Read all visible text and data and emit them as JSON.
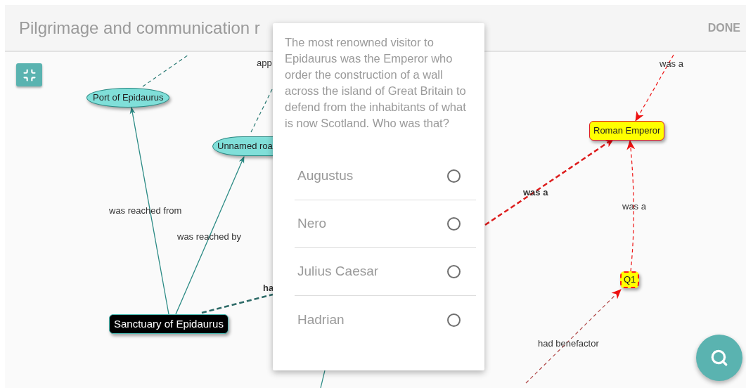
{
  "header": {
    "title": "Pilgrimage and communication r",
    "done": "DONE"
  },
  "graph": {
    "nodes": [
      {
        "label": "Port of Epidaurus",
        "kind": "place"
      },
      {
        "label": "Unnamed roa",
        "kind": "place"
      },
      {
        "label": "Sanctuary of Epidaurus",
        "kind": "focus"
      },
      {
        "label": "Roman Emperor",
        "kind": "answer"
      },
      {
        "label": "Q1",
        "kind": "question"
      }
    ],
    "edge_labels": [
      {
        "text": "app",
        "bold": false
      },
      {
        "text": "was a",
        "bold": false
      },
      {
        "text": "was reached from",
        "bold": false
      },
      {
        "text": "was reached by",
        "bold": false
      },
      {
        "text": "was a",
        "bold": true
      },
      {
        "text": "was a",
        "bold": false
      },
      {
        "text": "ha",
        "bold": true
      },
      {
        "text": "had benefactor",
        "bold": false
      }
    ]
  },
  "question": {
    "text": "The most renowned visitor to Epidaurus was the Emperor who order the construction of a wall across the island of Great Britain to defend from the inhabitants of what is now Scotland. Who was that?",
    "options": [
      {
        "label": "Augustus",
        "selected": false
      },
      {
        "label": "Nero",
        "selected": false
      },
      {
        "label": "Julius Caesar",
        "selected": false
      },
      {
        "label": "Hadrian",
        "selected": false
      }
    ]
  }
}
